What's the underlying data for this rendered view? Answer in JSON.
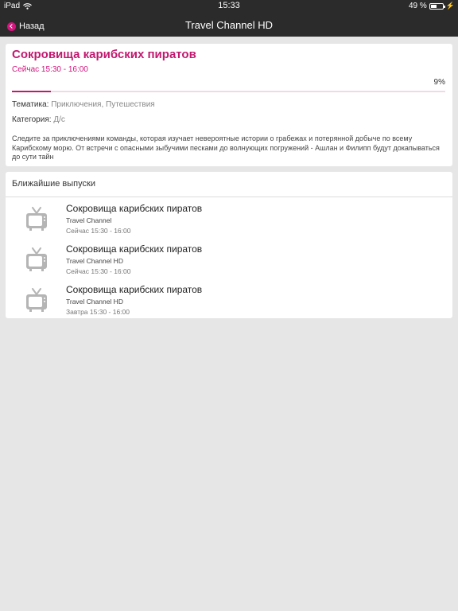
{
  "status_bar": {
    "device": "iPad",
    "time": "15:33",
    "battery": "49 %",
    "battery_level": 0.49
  },
  "nav": {
    "back_label": "Назад",
    "title": "Travel Channel HD"
  },
  "program": {
    "title": "Сокровища карибских пиратов",
    "time": "Сейчас 15:30 - 16:00",
    "progress_label": "9%",
    "progress": 0.09,
    "theme_label": "Тематика:",
    "theme_value": "Приключения, Путешествия",
    "category_label": "Категория:",
    "category_value": "Д/с",
    "description": "Следите за приключениями команды, которая изучает невероятные истории о грабежах и потерянной добыче по всему Карибскому морю. От встречи с опасными зыбучими песками до волнующих погружений - Ашлан и Филипп будут докапываться до сути тайн"
  },
  "upcoming": {
    "title": "Ближайшие выпуски",
    "icon": "tv-icon",
    "items": [
      {
        "title": "Сокровища карибских пиратов",
        "channel": "Travel Channel",
        "time": "Сейчас 15:30 - 16:00"
      },
      {
        "title": "Сокровища карибских пиратов",
        "channel": "Travel Channel HD",
        "time": "Сейчас 15:30 - 16:00"
      },
      {
        "title": "Сокровища карибских пиратов",
        "channel": "Travel Channel HD",
        "time": "Завтра 15:30 - 16:00"
      }
    ]
  },
  "colors": {
    "accent": "#d3157e",
    "title": "#c2186f",
    "nav_bg": "#2b2b2b",
    "page_bg": "#e6e6e6"
  }
}
